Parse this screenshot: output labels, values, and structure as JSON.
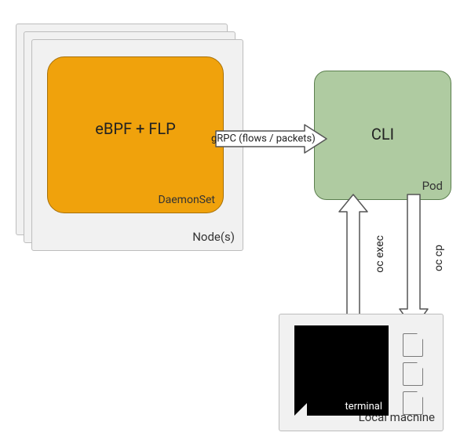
{
  "nodes_label": "Node(s)",
  "daemonset": {
    "title": "eBPF + FLP",
    "label": "DaemonSet"
  },
  "pod": {
    "title": "CLI",
    "label": "Pod"
  },
  "grpc": {
    "label": "gRPC (flows / packets)"
  },
  "oc_exec_label": "oc exec",
  "oc_cp_label": "oc cp",
  "local": {
    "box_label": "Local machine",
    "terminal_label": "terminal"
  },
  "colors": {
    "node_bg": "#f1f1f1",
    "node_border": "#bdbdbd",
    "daemonset_bg": "#f0a20c",
    "daemonset_border": "#a77008",
    "pod_bg": "#afcba1",
    "pod_border": "#5b7f4e",
    "terminal_bg": "#000000"
  }
}
